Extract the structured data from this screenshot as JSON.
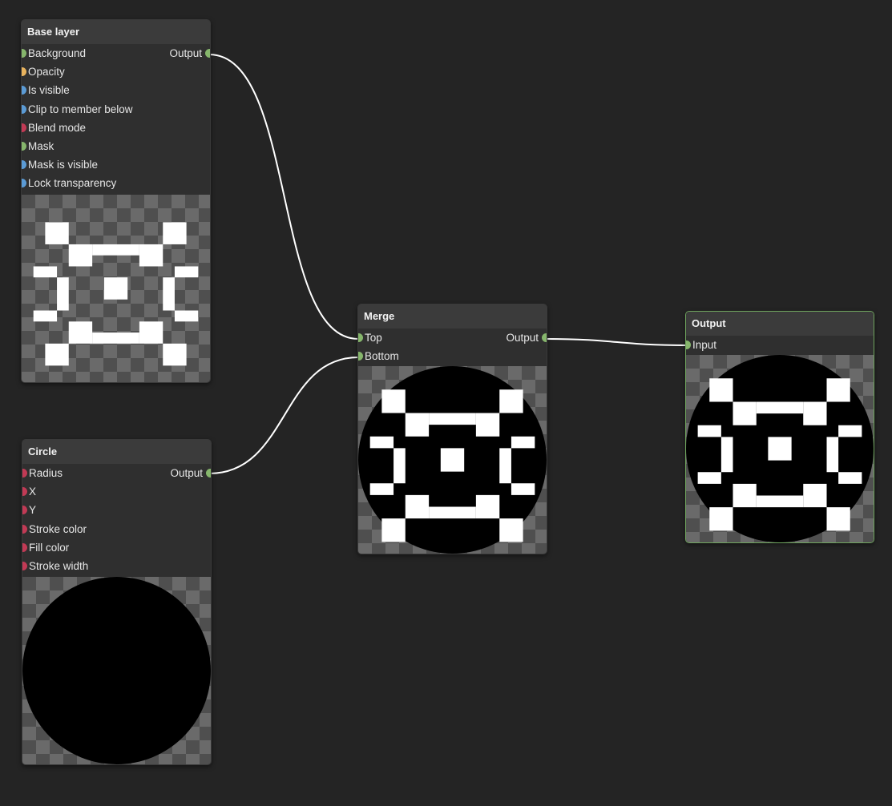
{
  "nodes": {
    "base_layer": {
      "title": "Base layer",
      "inputs": [
        {
          "label": "Background",
          "color": "#86b66c"
        },
        {
          "label": "Opacity",
          "color": "#e8b35e"
        },
        {
          "label": "Is visible",
          "color": "#5b9bd5"
        },
        {
          "label": "Clip to member below",
          "color": "#5b9bd5"
        },
        {
          "label": "Blend mode",
          "color": "#c23a55"
        },
        {
          "label": "Mask",
          "color": "#86b66c"
        },
        {
          "label": "Mask is visible",
          "color": "#5b9bd5"
        },
        {
          "label": "Lock transparency",
          "color": "#5b9bd5"
        }
      ],
      "output": "Output"
    },
    "circle": {
      "title": "Circle",
      "inputs": [
        {
          "label": "Radius",
          "color": "#c23a55"
        },
        {
          "label": "X",
          "color": "#c23a55"
        },
        {
          "label": "Y",
          "color": "#c23a55"
        },
        {
          "label": "Stroke color",
          "color": "#c23a55"
        },
        {
          "label": "Fill color",
          "color": "#c23a55"
        },
        {
          "label": "Stroke width",
          "color": "#c23a55"
        }
      ],
      "output": "Output"
    },
    "merge": {
      "title": "Merge",
      "inputs": [
        {
          "label": "Top",
          "color": "#86b66c"
        },
        {
          "label": "Bottom",
          "color": "#86b66c"
        }
      ],
      "output": "Output"
    },
    "output": {
      "title": "Output",
      "inputs": [
        {
          "label": "Input",
          "color": "#86b66c"
        }
      ]
    }
  },
  "colors": {
    "canvas_bg": "#242424",
    "wire": "#ffffff",
    "active_border": "#6fa55e"
  }
}
